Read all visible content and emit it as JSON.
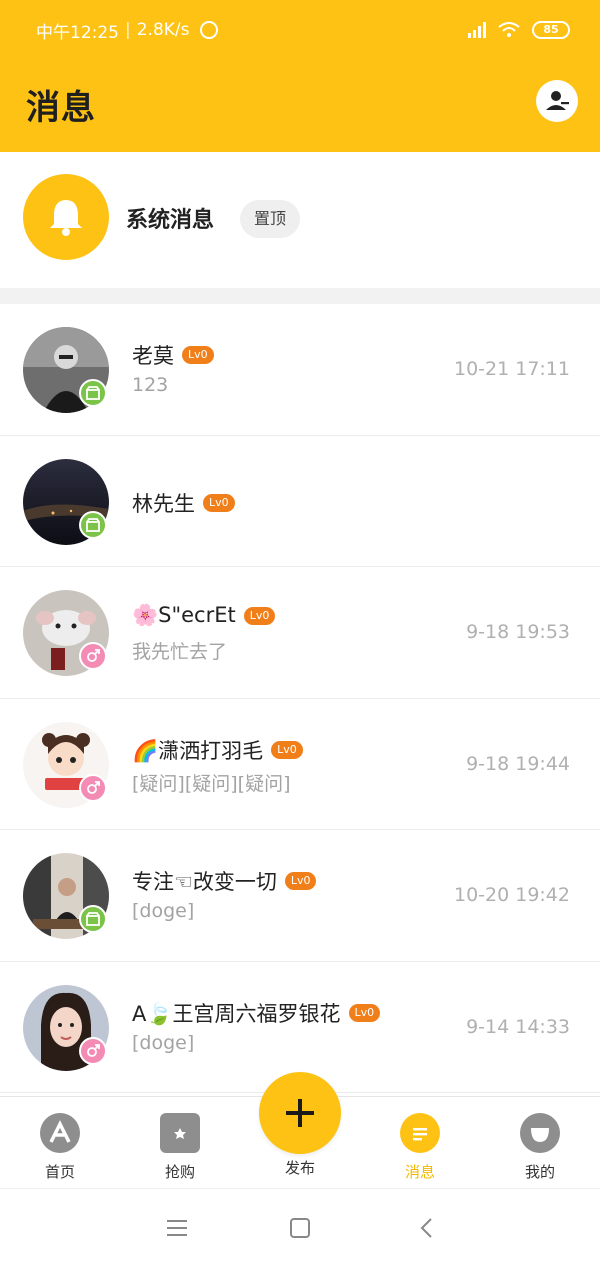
{
  "status_bar": {
    "time": "中午12:25",
    "speed": "2.8K/s",
    "battery": "85"
  },
  "header": {
    "title": "消息",
    "contacts_icon": "contacts-icon"
  },
  "system_message": {
    "icon": "bell-icon",
    "title": "系统消息",
    "pin_label": "置顶"
  },
  "conversations": [
    {
      "name": "老莫",
      "level": "Lv0",
      "preview": "123",
      "time": "10-21 17:11",
      "badge": "green"
    },
    {
      "name": "林先生",
      "level": "Lv0",
      "preview": "",
      "time": "",
      "badge": "green"
    },
    {
      "name": "🌸S\"ecrEt",
      "level": "Lv0",
      "preview": "我先忙去了",
      "time": "9-18 19:53",
      "badge": "pink"
    },
    {
      "name": "🌈潇洒打羽毛",
      "level": "Lv0",
      "preview": "[疑问][疑问][疑问]",
      "time": "9-18 19:44",
      "badge": "pink"
    },
    {
      "name": "专注☜改变一切",
      "level": "Lv0",
      "preview": "[doge]",
      "time": "10-20 19:42",
      "badge": "green"
    },
    {
      "name": "A🍃王宫周六福罗银花",
      "level": "Lv0",
      "preview": "[doge]",
      "time": "9-14 14:33",
      "badge": "pink"
    }
  ],
  "bottom_nav": {
    "home": "首页",
    "buy": "抢购",
    "publish": "发布",
    "messages": "消息",
    "mine": "我的"
  },
  "colors": {
    "brand": "#FDC214",
    "level_badge": "#F07F1A",
    "active_nav": "#F5B800"
  }
}
